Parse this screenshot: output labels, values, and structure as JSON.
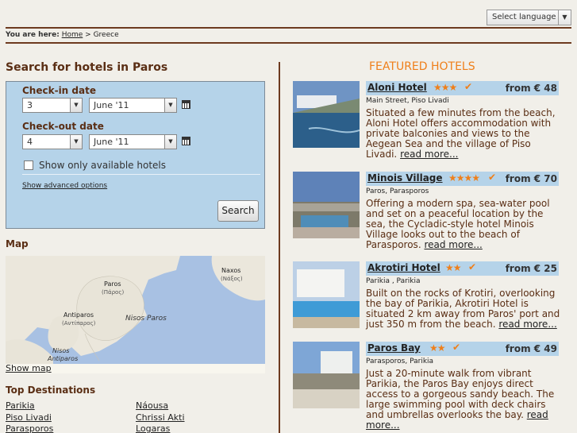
{
  "header": {
    "language": "Select language",
    "breadcrumb": {
      "label": "You are here:",
      "home": "Home",
      "sep": ">",
      "current": "Greece"
    }
  },
  "search": {
    "title": "Search for hotels in Paros",
    "checkin": {
      "label": "Check-in date",
      "day": "3",
      "month": "June '11"
    },
    "checkout": {
      "label": "Check-out date",
      "day": "4",
      "month": "June '11"
    },
    "available_label": "Show only available hotels",
    "advanced": "Show advanced options",
    "button": "Search"
  },
  "map": {
    "title": "Map",
    "labels": {
      "paros": "Paros",
      "paros_gr": "(Πάρος)",
      "naxos": "Naxos",
      "naxos_gr": "(Νάξος)",
      "antiparos": "Antiparos",
      "antiparos_gr": "(Αντίπαρος)",
      "nisos_paros": "Nisos Paros",
      "nisos": "Nisos",
      "nisos_antiparos": "Antiparos"
    },
    "show": "Show map"
  },
  "destinations": {
    "title": "Top Destinations",
    "col1": [
      "Parikia",
      "Piso Livadi",
      "Parasporos"
    ],
    "col2": [
      "Náousa",
      "Chrissi Akti",
      "Logaras"
    ]
  },
  "featured": {
    "title": "FEATURED HOTELS",
    "hotels": [
      {
        "name": "Aloni Hotel",
        "stars": "★★★",
        "price": "from € 48",
        "address": "Main Street, Piso Livadi",
        "desc": "Situated a few minutes from the beach, Aloni Hotel offers accommodation with private balconies and views to the Aegean Sea and the village of Piso Livadi.",
        "more": "read more..."
      },
      {
        "name": "Minois Village",
        "stars": "★★★★",
        "price": "from € 70",
        "address": "Paros, Parasporos",
        "desc": "Offering a modern spa, sea-water pool and set on a peaceful location by the sea, the Cycladic-style hotel Minois Village looks out to the beach of Parasporos.",
        "more": "read more..."
      },
      {
        "name": "Akrotiri Hotel",
        "stars": "★★",
        "price": "from € 25",
        "address": "Parikia , Parikia",
        "desc": "Built on the rocks of Krotiri, overlooking the bay of Parikia, Akrotiri Hotel is situated 2 km away from Paros' port and just 350 m from the beach.",
        "more": "read more..."
      },
      {
        "name": "Paros Bay",
        "stars": "★★",
        "price": "from € 49",
        "address": "Parasporos, Parikia",
        "desc": "Just a 20-minute walk from vibrant Parikia, the Paros Bay enjoys direct access to a gorgeous sandy beach. The large swimming pool with deck chairs and umbrellas overlooks the bay.",
        "more": "read more..."
      }
    ]
  }
}
